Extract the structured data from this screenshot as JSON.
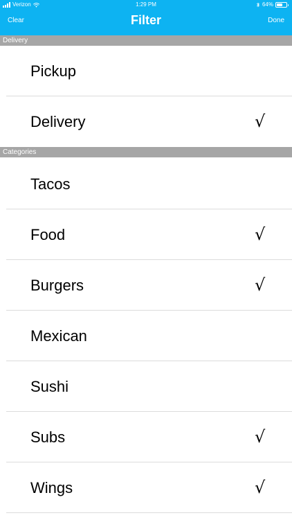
{
  "status_bar": {
    "carrier": "Verizon",
    "time": "1:29 PM",
    "battery_percent": "64%",
    "battery_level": 0.64
  },
  "nav": {
    "clear_label": "Clear",
    "title": "Filter",
    "done_label": "Done"
  },
  "colors": {
    "nav_background": "#0db3f2",
    "section_background": "#a6a6a6"
  },
  "check_mark": "√",
  "sections": [
    {
      "header": "Delivery",
      "items": [
        {
          "label": "Pickup",
          "checked": false
        },
        {
          "label": "Delivery",
          "checked": true
        }
      ]
    },
    {
      "header": "Categories",
      "items": [
        {
          "label": "Tacos",
          "checked": false
        },
        {
          "label": "Food",
          "checked": true
        },
        {
          "label": "Burgers",
          "checked": true
        },
        {
          "label": "Mexican",
          "checked": false
        },
        {
          "label": "Sushi",
          "checked": false
        },
        {
          "label": "Subs",
          "checked": true
        },
        {
          "label": "Wings",
          "checked": true
        }
      ]
    }
  ]
}
